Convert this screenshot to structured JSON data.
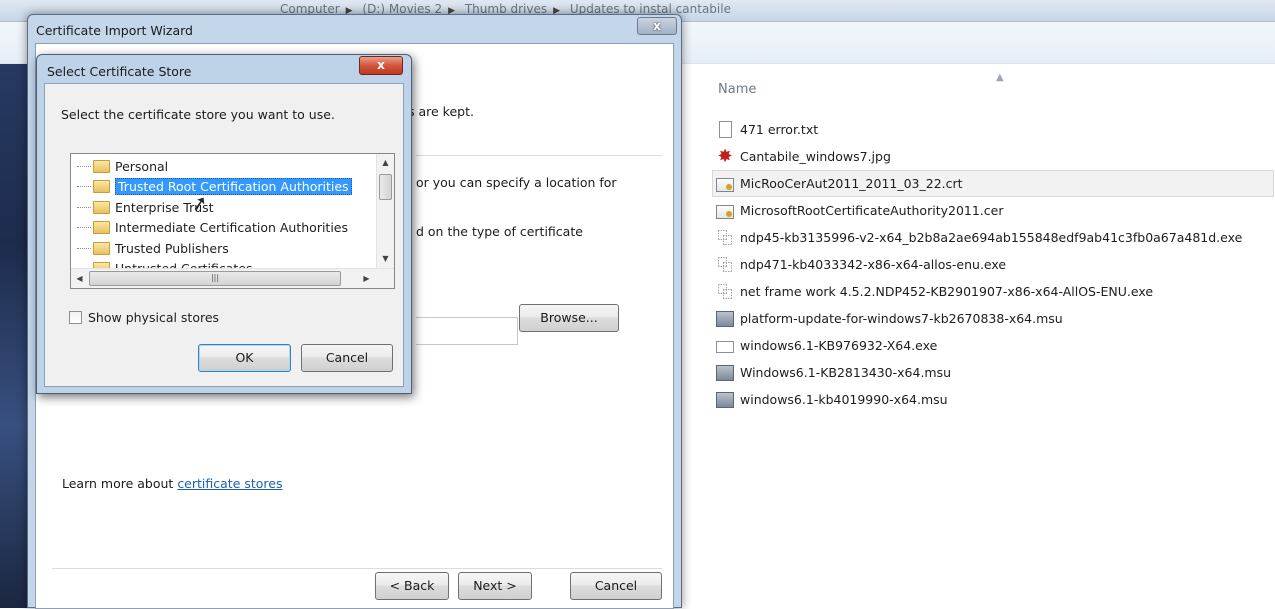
{
  "explorer": {
    "breadcrumbs": [
      "Computer",
      "(D:) Movies 2",
      "Thumb drives",
      "Updates to instal cantabile"
    ],
    "column_header": "Name",
    "files": [
      {
        "name": "471 error.txt",
        "icon": "text-file-icon"
      },
      {
        "name": "Cantabile_windows7.jpg",
        "icon": "image-file-icon"
      },
      {
        "name": "MicRooCerAut2011_2011_03_22.crt",
        "icon": "certificate-file-icon",
        "selected": true
      },
      {
        "name": "MicrosoftRootCertificateAuthority2011.cer",
        "icon": "certificate-file-icon"
      },
      {
        "name": "ndp45-kb3135996-v2-x64_b2b8a2ae694ab155848edf9ab41c3fb0a67a481d.exe",
        "icon": "installer-icon"
      },
      {
        "name": "ndp471-kb4033342-x86-x64-allos-enu.exe",
        "icon": "installer-icon"
      },
      {
        "name": "net frame work 4.5.2.NDP452-KB2901907-x86-x64-AllOS-ENU.exe",
        "icon": "installer-icon"
      },
      {
        "name": "platform-update-for-windows7-kb2670838-x64.msu",
        "icon": "update-package-icon"
      },
      {
        "name": "windows6.1-KB976932-X64.exe",
        "icon": "executable-icon"
      },
      {
        "name": "Windows6.1-KB2813430-x64.msu",
        "icon": "update-package-icon"
      },
      {
        "name": "windows6.1-kb4019990-x64.msu",
        "icon": "update-package-icon"
      }
    ]
  },
  "wizard": {
    "title": "Certificate Import Wizard",
    "close_label": "x",
    "text_kept": "s are kept.",
    "text_location": "or you can specify a location for",
    "text_type": "d on the type of certificate",
    "browse_label": "Browse...",
    "learn_prefix": "Learn more about ",
    "learn_link": "certificate stores",
    "back_label": "< Back",
    "next_label": "Next >",
    "cancel_label": "Cancel"
  },
  "dialog": {
    "title": "Select Certificate Store",
    "close_label": "x",
    "prompt": "Select the certificate store you want to use.",
    "stores": [
      {
        "label": "Personal"
      },
      {
        "label": "Trusted Root Certification Authorities",
        "selected": true
      },
      {
        "label": "Enterprise Trust"
      },
      {
        "label": "Intermediate Certification Authorities"
      },
      {
        "label": "Trusted Publishers"
      },
      {
        "label": "Untrusted Certificates"
      }
    ],
    "show_physical_label": "Show physical stores",
    "show_physical_checked": false,
    "ok_label": "OK",
    "cancel_label": "Cancel"
  },
  "colors": {
    "selection": "#3399ff",
    "link": "#1a5fb4",
    "close_red": "#c03a22"
  }
}
